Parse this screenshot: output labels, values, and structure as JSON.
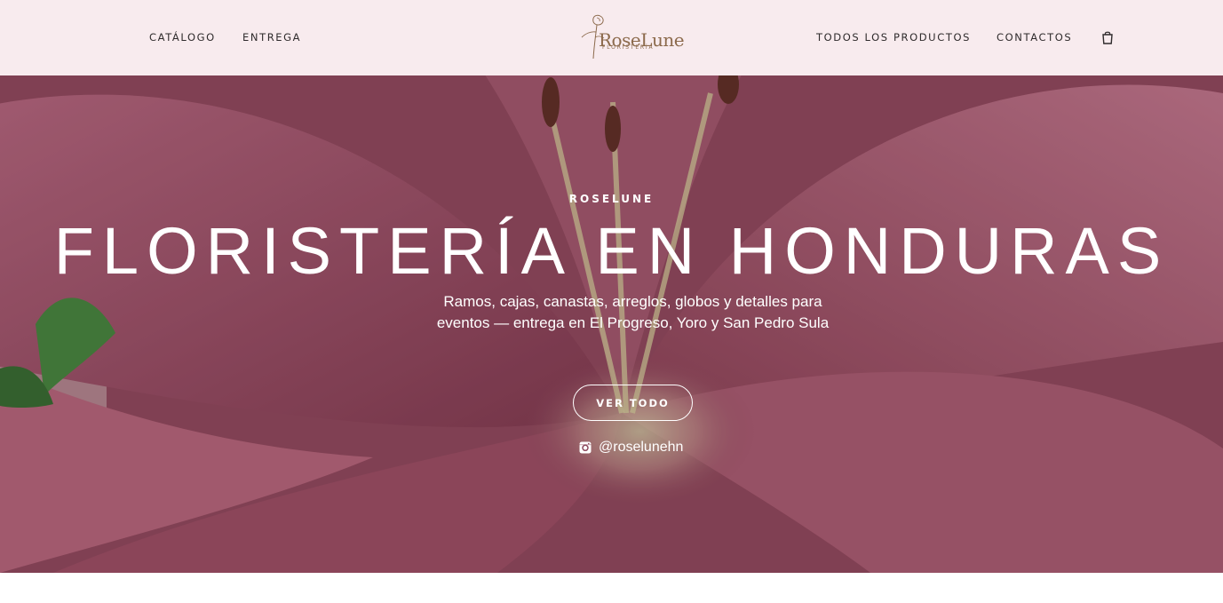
{
  "header": {
    "nav_left": [
      "CATÁLOGO",
      "ENTREGA"
    ],
    "nav_right": [
      "TODOS LOS PRODUCTOS",
      "CONTACTOS"
    ],
    "logo": {
      "name": "RoseLune",
      "tagline": "FLORISTERÍA"
    },
    "cart_icon": "shopping-bag-icon"
  },
  "hero": {
    "eyebrow": "ROSELUNE",
    "title": "FLORISTERÍA EN HONDURAS",
    "subtitle": "Ramos, cajas, canastas, arreglos, globos y detalles para eventos — entrega en El Progreso, Yoro y San Pedro Sula",
    "cta_label": "VER TODO",
    "instagram_handle": "@roselunehn",
    "instagram_icon": "instagram-icon"
  },
  "colors": {
    "header_bg": "#f8ebee",
    "nav_text": "#2f2b2c",
    "logo_color": "#8c6a4c",
    "hero_text": "#ffffff",
    "petal_pink": "#a65670"
  }
}
